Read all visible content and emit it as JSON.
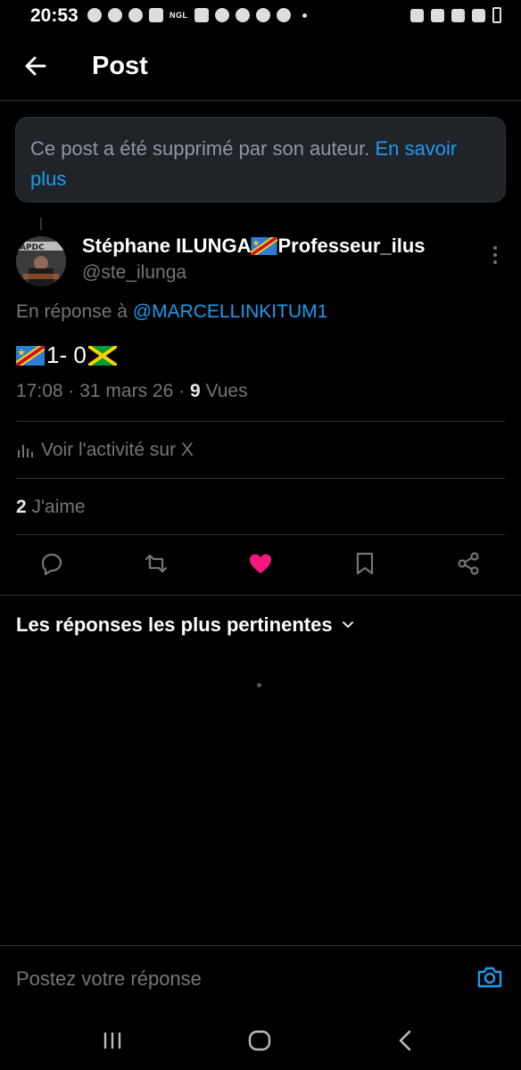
{
  "status_bar": {
    "time": "20:53",
    "ngl": "NGL"
  },
  "header": {
    "title": "Post"
  },
  "notice": {
    "text": "Ce post a été supprimé par son auteur.",
    "link": "En savoir plus"
  },
  "post": {
    "author_name": "Stéphane ILUNGA",
    "author_suffix": "Professeur_ilus",
    "handle": "@ste_ilunga",
    "reply_prefix": "En réponse à",
    "reply_to": "@MARCELLINKITUM1",
    "text": "1- 0",
    "time": "17:08",
    "date": "31 mars 26",
    "views_count": "9",
    "views_label": "Vues",
    "activity_label": "Voir l'activité sur X",
    "likes_count": "2",
    "likes_label": "J'aime"
  },
  "replies": {
    "sort_label": "Les réponses les plus pertinentes"
  },
  "compose": {
    "placeholder": "Postez votre réponse"
  },
  "colors": {
    "accent": "#1d9bf0",
    "like": "#f91880",
    "background": "#000000"
  },
  "icons": [
    "back-arrow-icon",
    "more-icon",
    "reply-icon",
    "repost-icon",
    "heart-icon",
    "bookmark-icon",
    "share-icon",
    "analytics-icon",
    "chevron-down-icon",
    "camera-icon"
  ]
}
